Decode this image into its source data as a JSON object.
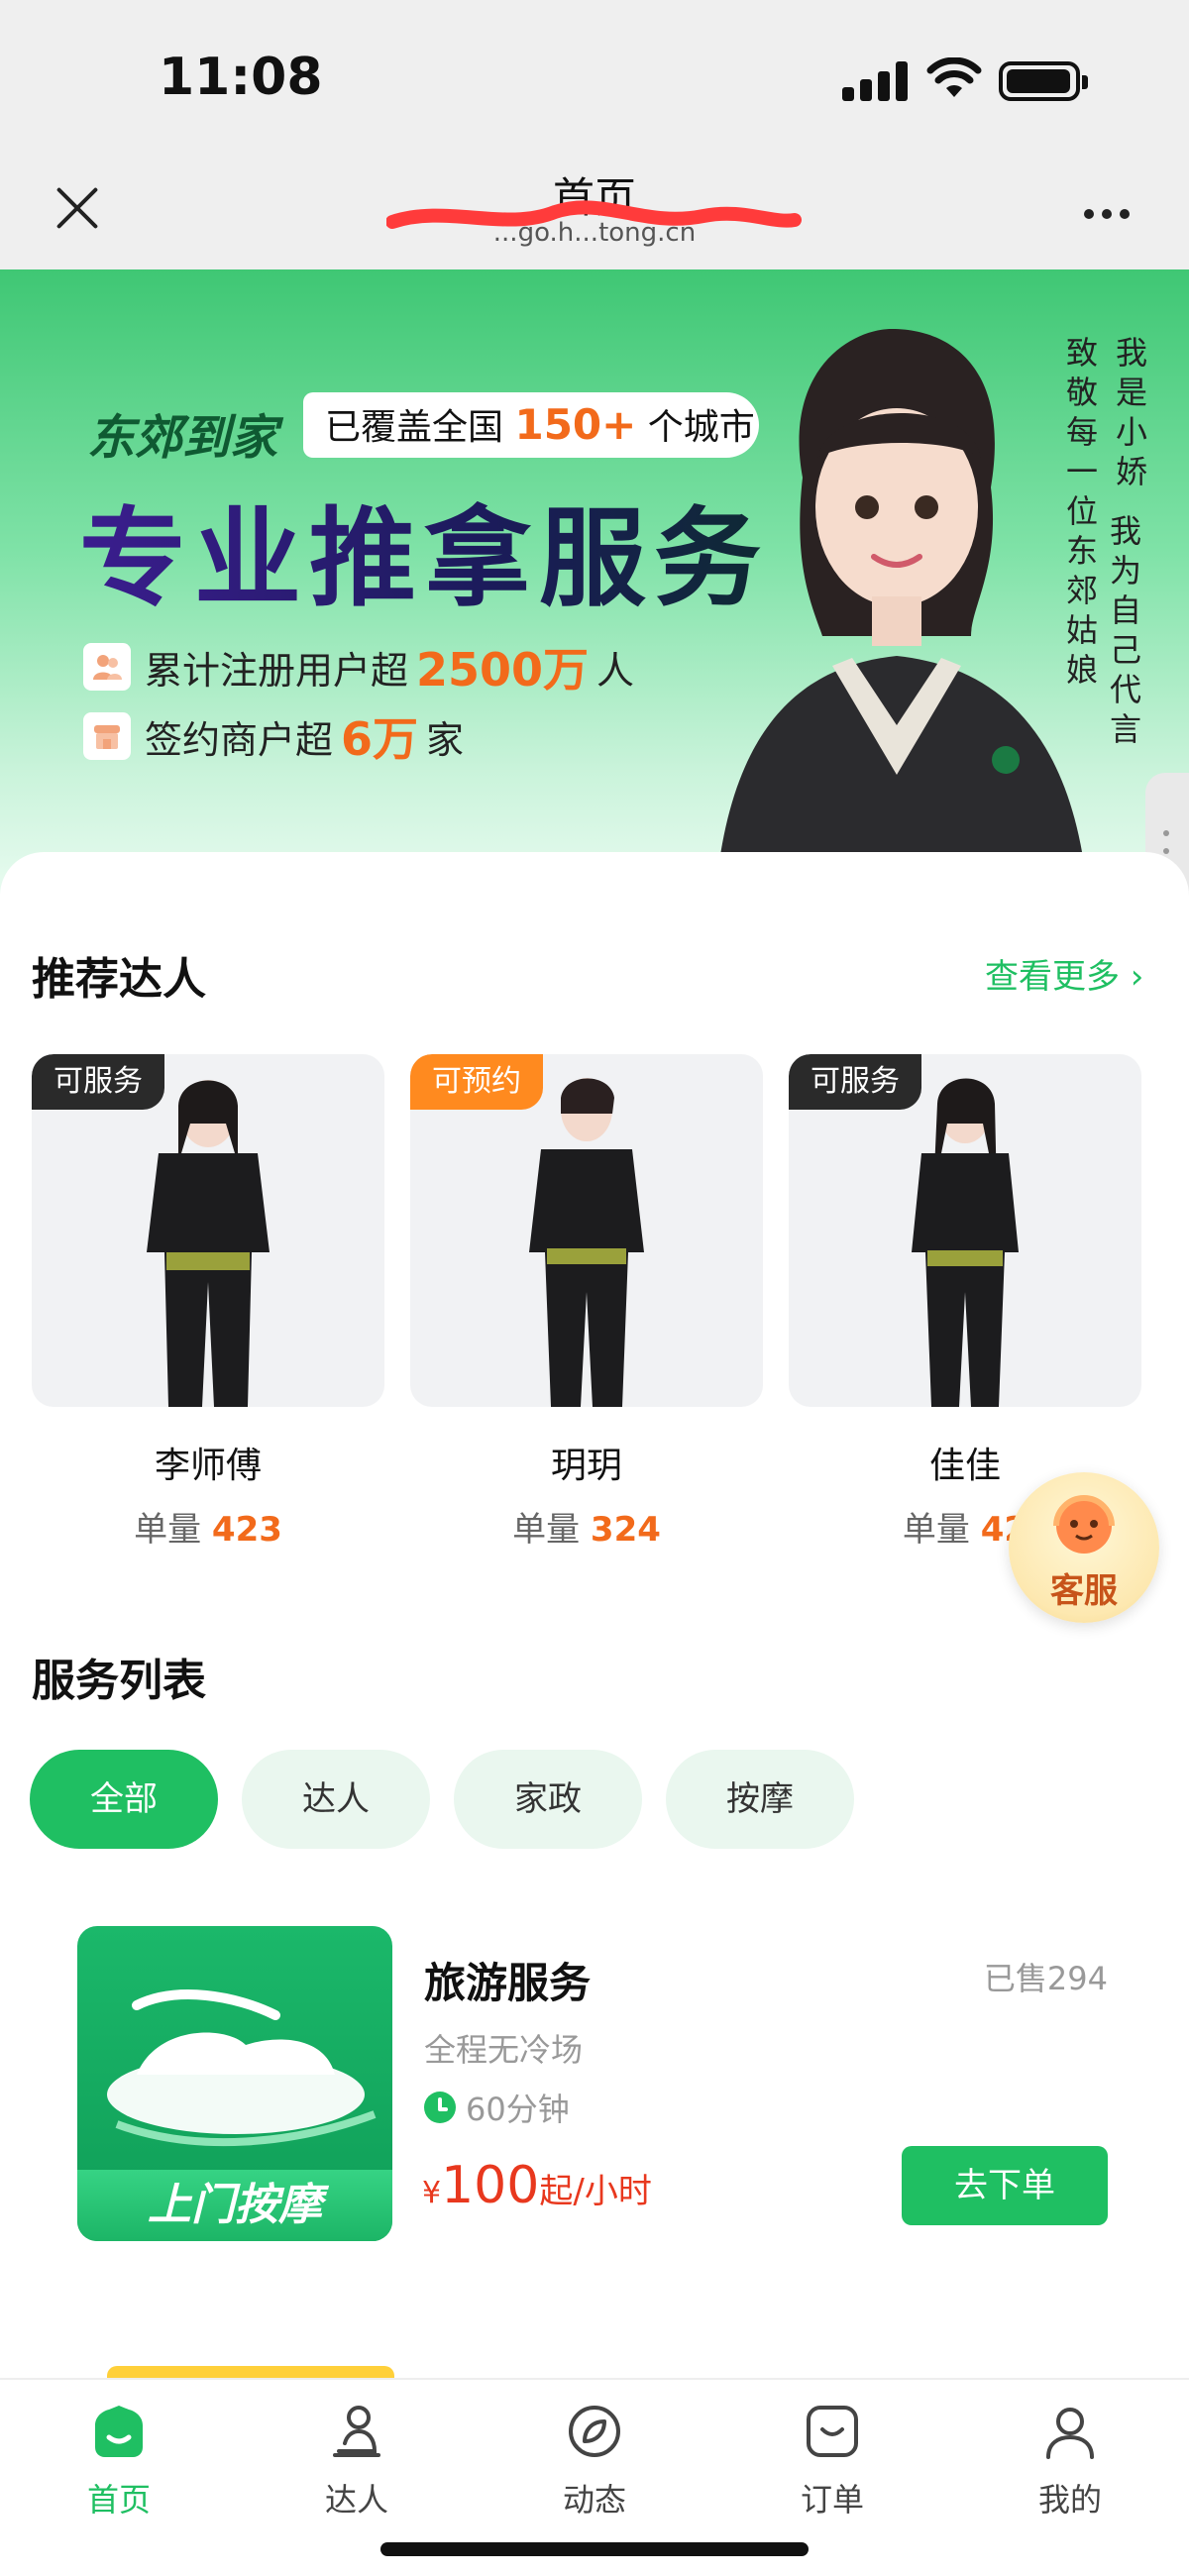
{
  "status_bar": {
    "time": "11:08"
  },
  "nav": {
    "title": "首页",
    "subtitle": "...go.h...tong.cn"
  },
  "banner": {
    "brand": "东郊到家",
    "coverage_prefix": "已覆盖全国",
    "coverage_value": "150+",
    "coverage_suffix": "个城市",
    "headline": "专业推拿服务",
    "stat1_prefix": "累计注册用户超",
    "stat1_value": "2500万",
    "stat1_suffix": "人",
    "stat2_prefix": "签约商户超",
    "stat2_value": "6万",
    "stat2_suffix": "家",
    "vertical_col1": "我是小娇",
    "vertical_col2": "我为自己代言",
    "vertical_col3": "致敬每一位东郊姑娘"
  },
  "recommended": {
    "title": "推荐达人",
    "see_more": "查看更多",
    "talents": [
      {
        "tag": "可服务",
        "tag_color": "#2a2a2a",
        "name": "李师傅",
        "orders_label": "单量",
        "orders": "423"
      },
      {
        "tag": "可预约",
        "tag_color": "#ff8a1f",
        "name": "玥玥",
        "orders_label": "单量",
        "orders": "324"
      },
      {
        "tag": "可服务",
        "tag_color": "#2a2a2a",
        "name": "佳佳",
        "orders_label": "单量",
        "orders": "42"
      }
    ]
  },
  "customer_service": {
    "label": "客服"
  },
  "services": {
    "title": "服务列表",
    "chips": [
      "全部",
      "达人",
      "家政",
      "按摩"
    ],
    "active_chip": "全部",
    "items": [
      {
        "thumb_text": "上门按摩",
        "title": "旅游服务",
        "sold": "已售294",
        "desc": "全程无冷场",
        "duration": "60分钟",
        "price_currency": "¥",
        "price_value": "100",
        "price_unit": "起/小时",
        "order_button": "去下单"
      }
    ]
  },
  "tabbar": {
    "tabs": [
      {
        "label": "首页",
        "icon": "home-icon"
      },
      {
        "label": "达人",
        "icon": "talent-icon"
      },
      {
        "label": "动态",
        "icon": "compass-icon"
      },
      {
        "label": "订单",
        "icon": "order-icon"
      },
      {
        "label": "我的",
        "icon": "profile-icon"
      }
    ],
    "active": "首页"
  },
  "colors": {
    "accent": "#1fbf62",
    "price": "#e8381e",
    "highlight": "#f26a1b"
  }
}
